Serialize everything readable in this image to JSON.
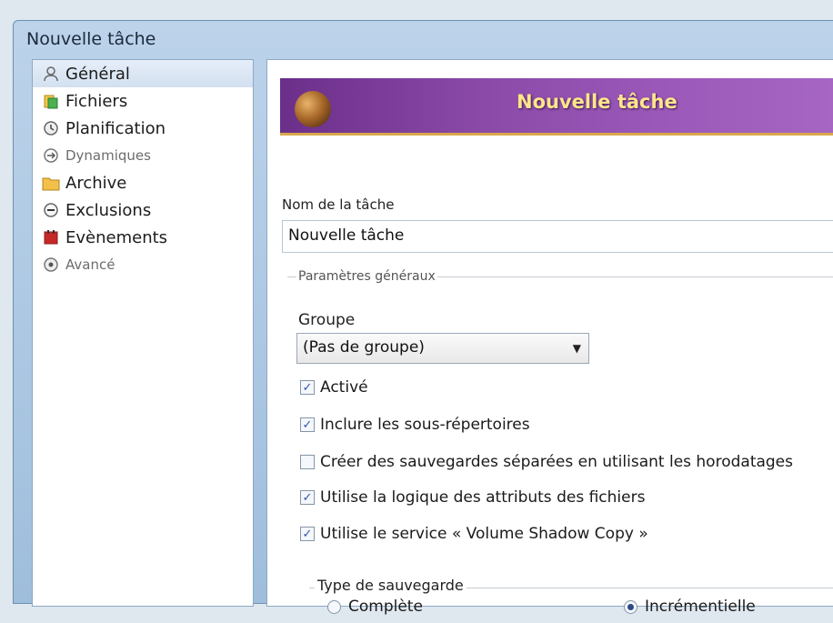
{
  "window": {
    "title": "Nouvelle tâche"
  },
  "sidebar": {
    "items": [
      {
        "label": "Général",
        "icon": "user-icon",
        "selected": true
      },
      {
        "label": "Fichiers",
        "icon": "files-icon"
      },
      {
        "label": "Planification",
        "icon": "clock-icon"
      },
      {
        "label": "Dynamiques",
        "icon": "dynamic-icon"
      },
      {
        "label": "Archive",
        "icon": "folder-icon"
      },
      {
        "label": "Exclusions",
        "icon": "minus-circle-icon"
      },
      {
        "label": "Evènements",
        "icon": "events-icon"
      },
      {
        "label": "Avancé",
        "icon": "advanced-icon"
      }
    ]
  },
  "banner": {
    "title": "Nouvelle tâche"
  },
  "form": {
    "name_label": "Nom de la tâche",
    "name_value": "Nouvelle tâche",
    "general_legend": "Paramètres généraux",
    "group_label": "Groupe",
    "group_value": "(Pas de groupe)",
    "checks": [
      {
        "label": "Activé",
        "checked": true
      },
      {
        "label": "Inclure les sous-répertoires",
        "checked": true
      },
      {
        "label": "Créer des sauvegardes séparées en utilisant les horodatages",
        "checked": false
      },
      {
        "label": "Utilise la logique des attributs des fichiers",
        "checked": true
      },
      {
        "label": "Utilise le service « Volume Shadow Copy »",
        "checked": true
      }
    ],
    "backup_type_label": "Type de sauvegarde",
    "backup_types": [
      {
        "label": "Complète",
        "selected": false
      },
      {
        "label": "Incrémentielle",
        "selected": true
      }
    ]
  },
  "colors": {
    "banner": "#8b4aa8",
    "banner_title": "#ffe68a",
    "accent": "#2a4a86"
  }
}
